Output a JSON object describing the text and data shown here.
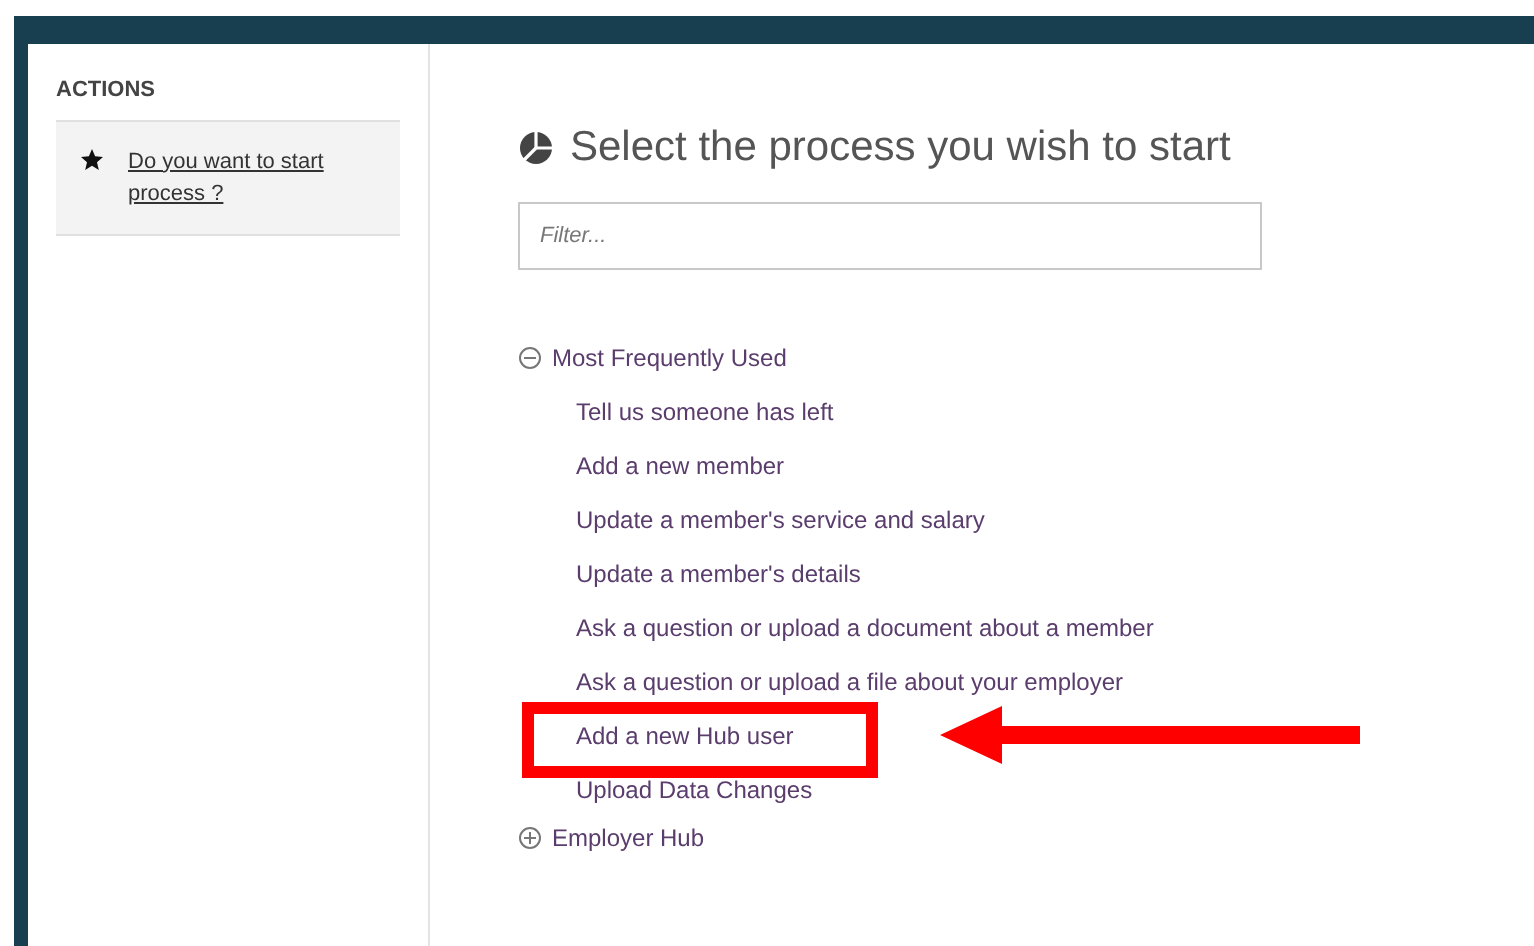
{
  "sidebar": {
    "heading": "ACTIONS",
    "actions": [
      {
        "label": "Do you want to start process ?"
      }
    ]
  },
  "main": {
    "title": "Select the process you wish to start",
    "filter": {
      "placeholder": "Filter..."
    },
    "groups": [
      {
        "label": "Most Frequently Used",
        "expanded": true,
        "children": [
          {
            "label": "Tell us someone has left",
            "highlighted": false
          },
          {
            "label": "Add a new member",
            "highlighted": false
          },
          {
            "label": "Update a member's service and salary",
            "highlighted": false
          },
          {
            "label": "Update a member's details",
            "highlighted": false
          },
          {
            "label": "Ask a question or upload a document about a member",
            "highlighted": false
          },
          {
            "label": "Ask a question or upload a file about your employer",
            "highlighted": false
          },
          {
            "label": "Add a new Hub user",
            "highlighted": true
          },
          {
            "label": "Upload Data Changes",
            "highlighted": false
          }
        ]
      },
      {
        "label": "Employer Hub",
        "expanded": false
      }
    ]
  }
}
